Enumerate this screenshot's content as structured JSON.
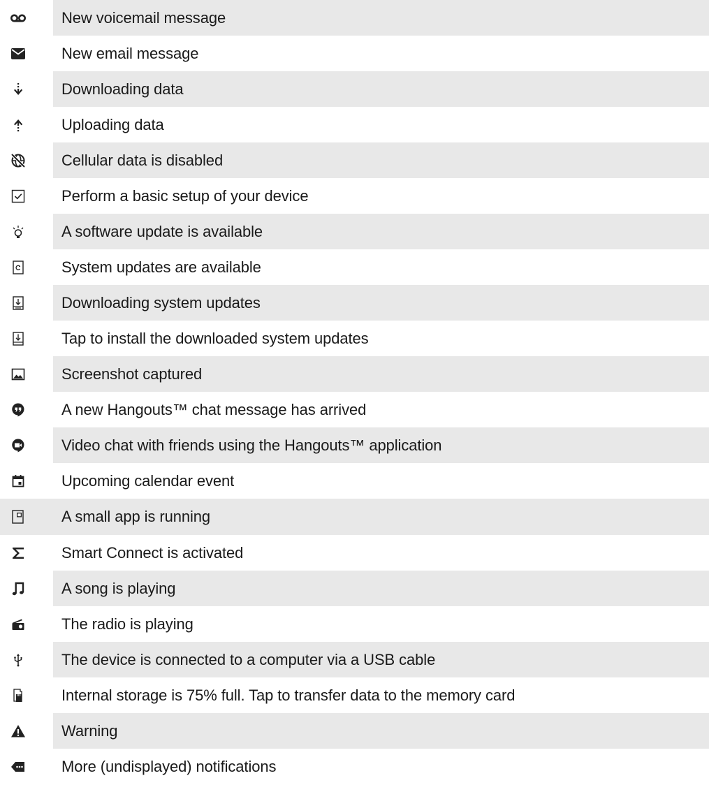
{
  "rows": [
    {
      "icon": "voicemail-icon",
      "label": "New voicemail message"
    },
    {
      "icon": "email-icon",
      "label": "New email message"
    },
    {
      "icon": "download-icon",
      "label": "Downloading data"
    },
    {
      "icon": "upload-icon",
      "label": "Uploading data"
    },
    {
      "icon": "cellular-disabled-icon",
      "label": "Cellular data is disabled"
    },
    {
      "icon": "setup-checkbox-icon",
      "label": "Perform a basic setup of your device"
    },
    {
      "icon": "lightbulb-icon",
      "label": "A software update is available"
    },
    {
      "icon": "system-update-icon",
      "label": "System updates are available"
    },
    {
      "icon": "downloading-system-update-icon",
      "label": "Downloading system updates"
    },
    {
      "icon": "install-update-icon",
      "label": "Tap to install the downloaded system updates"
    },
    {
      "icon": "screenshot-icon",
      "label": "Screenshot captured"
    },
    {
      "icon": "hangouts-icon",
      "label": "A new Hangouts™ chat message has arrived"
    },
    {
      "icon": "hangouts-video-icon",
      "label": "Video chat with friends using the Hangouts™ application"
    },
    {
      "icon": "calendar-icon",
      "label": "Upcoming calendar event"
    },
    {
      "icon": "small-app-icon",
      "label": "A small app is running"
    },
    {
      "icon": "smart-connect-icon",
      "label": "Smart Connect is activated"
    },
    {
      "icon": "music-note-icon",
      "label": "A song is playing"
    },
    {
      "icon": "radio-icon",
      "label": "The radio is playing"
    },
    {
      "icon": "usb-icon",
      "label": "The device is connected to a computer via a USB cable"
    },
    {
      "icon": "storage-icon",
      "label": "Internal storage is 75% full. Tap to transfer data to the memory card"
    },
    {
      "icon": "warning-icon",
      "label": "Warning"
    },
    {
      "icon": "more-notifications-icon",
      "label": "More (undisplayed) notifications"
    }
  ],
  "colors": {
    "row_shade": "#e8e8e8",
    "icon": "#222222",
    "text": "#1a1a1a"
  }
}
